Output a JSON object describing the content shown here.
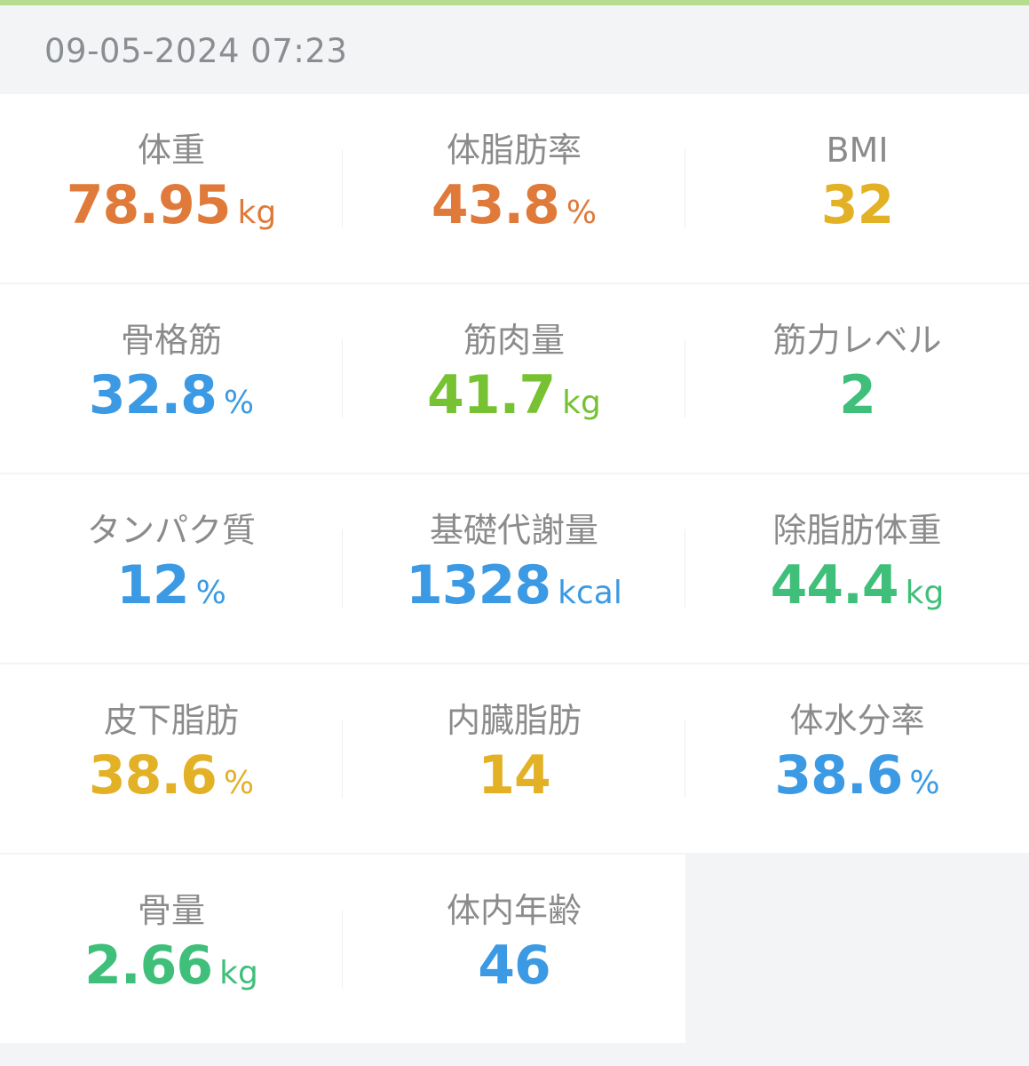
{
  "header": {
    "timestamp": "09-05-2024 07:23"
  },
  "metrics": [
    {
      "label": "体重",
      "value": "78.95",
      "unit": "kg",
      "color": "#e07a3a"
    },
    {
      "label": "体脂肪率",
      "value": "43.8",
      "unit": "%",
      "color": "#e07a3a"
    },
    {
      "label": "BMI",
      "value": "32",
      "unit": "",
      "color": "#e3b126"
    },
    {
      "label": "骨格筋",
      "value": "32.8",
      "unit": "%",
      "color": "#3b9ae3"
    },
    {
      "label": "筋肉量",
      "value": "41.7",
      "unit": "kg",
      "color": "#76c232"
    },
    {
      "label": "筋力レベル",
      "value": "2",
      "unit": "",
      "color": "#3fbf7a"
    },
    {
      "label": "タンパク質",
      "value": "12",
      "unit": "%",
      "color": "#3b9ae3"
    },
    {
      "label": "基礎代謝量",
      "value": "1328",
      "unit": "kcal",
      "color": "#3b9ae3"
    },
    {
      "label": "除脂肪体重",
      "value": "44.4",
      "unit": "kg",
      "color": "#3fbf7a"
    },
    {
      "label": "皮下脂肪",
      "value": "38.6",
      "unit": "%",
      "color": "#e3b126"
    },
    {
      "label": "内臓脂肪",
      "value": "14",
      "unit": "",
      "color": "#e3b126"
    },
    {
      "label": "体水分率",
      "value": "38.6",
      "unit": "%",
      "color": "#3b9ae3"
    },
    {
      "label": "骨量",
      "value": "2.66",
      "unit": "kg",
      "color": "#3fbf7a"
    },
    {
      "label": "体内年齢",
      "value": "46",
      "unit": "",
      "color": "#3b9ae3"
    }
  ]
}
